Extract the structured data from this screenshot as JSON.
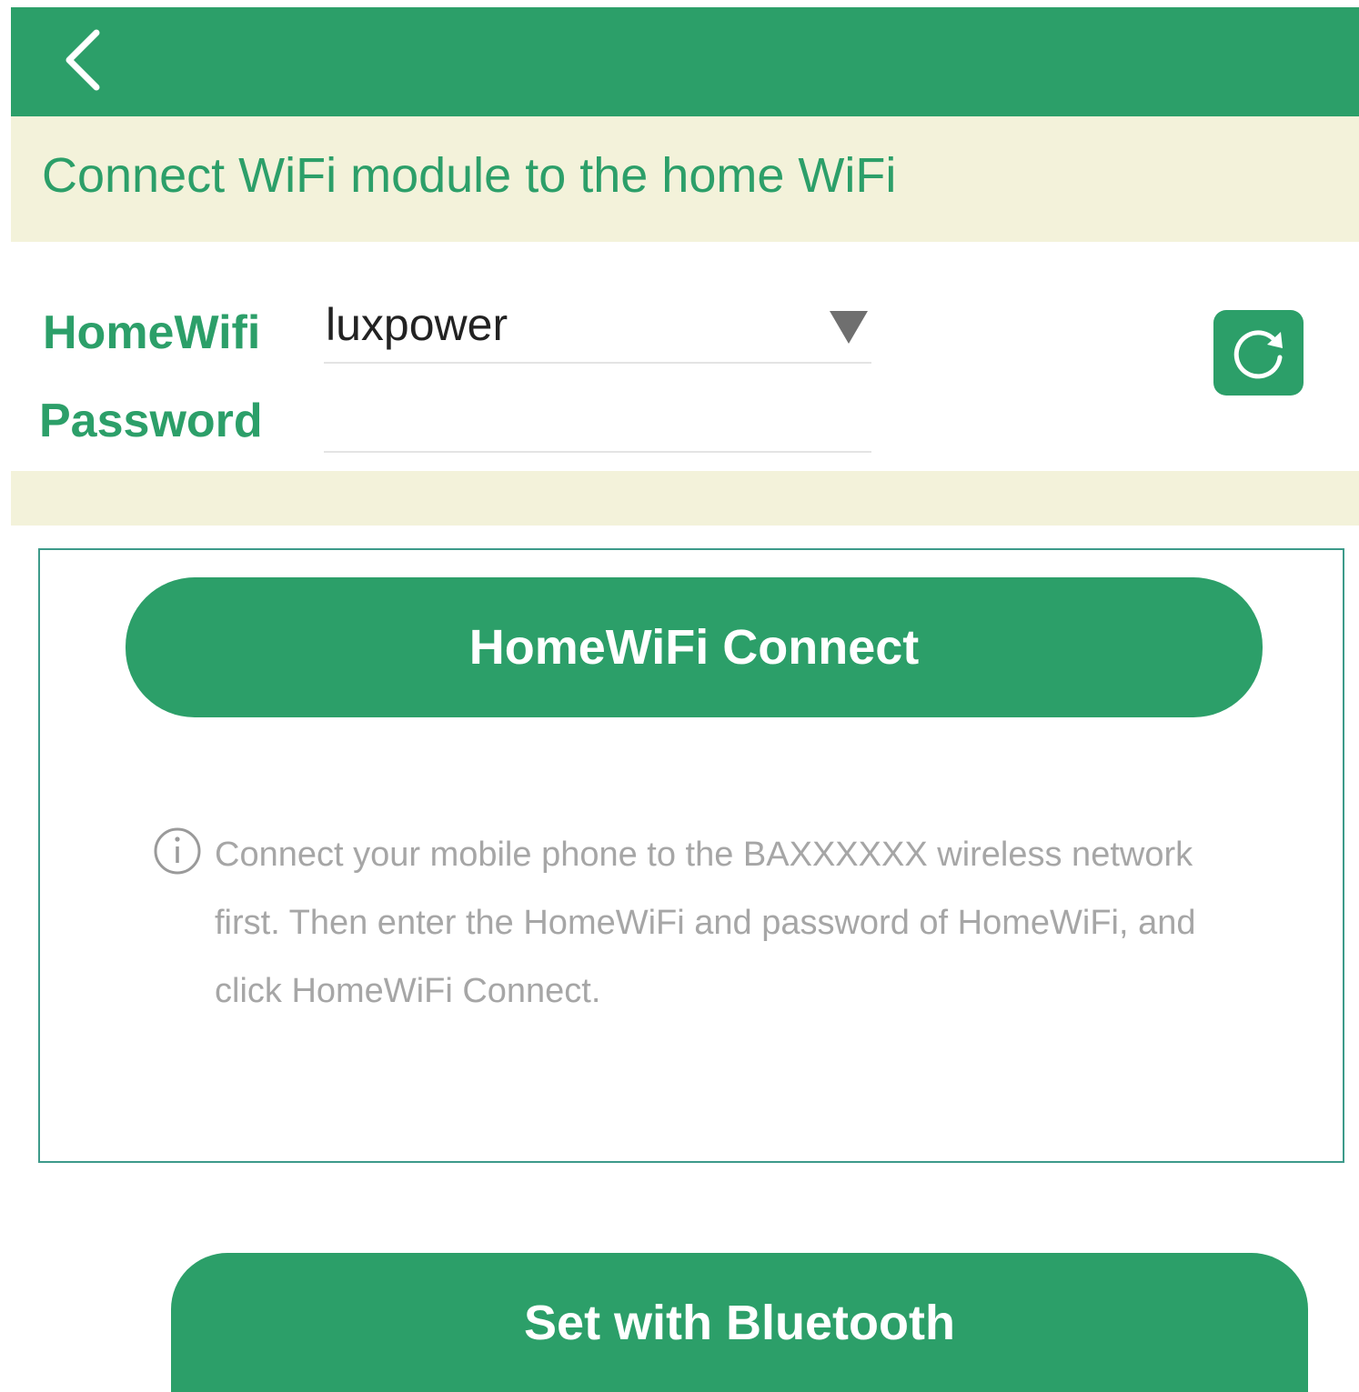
{
  "header": {
    "back_icon": "chevron-left-icon",
    "background_color": "#2c9f69"
  },
  "subtitle": "Connect WiFi module to the home WiFi",
  "form": {
    "homewifi_label": "HomeWifi",
    "homewifi_value": "luxpower",
    "password_label": "Password",
    "password_value": "",
    "refresh_icon": "refresh-icon",
    "dropdown_icon": "triangle-down-icon"
  },
  "panel": {
    "connect_button_label": "HomeWiFi Connect",
    "info_icon": "info-circle-icon",
    "info_text": "Connect your mobile phone to the BAXXXXXX wireless network first. Then enter the HomeWiFi and password of HomeWiFi, and click HomeWiFi Connect."
  },
  "bluetooth_button_label": "Set with Bluetooth",
  "colors": {
    "accent_green": "#2c9f69",
    "band_cream": "#f3f2da",
    "panel_border": "#3d9a8a",
    "info_text_gray": "#a6a6a6"
  }
}
